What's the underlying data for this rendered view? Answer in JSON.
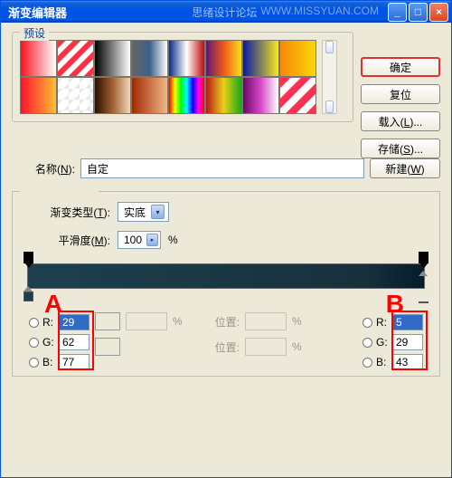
{
  "window": {
    "title": "渐变编辑器"
  },
  "watermark": {
    "a": "思绪设计论坛",
    "b": "WWW.MISSYUAN.COM"
  },
  "buttons": {
    "ok": "确定",
    "reset": "复位",
    "load": "载入(L)...",
    "save": "存储(S)...",
    "new": "新建(W)"
  },
  "labels": {
    "presets": "预设",
    "name": "名称(N):",
    "name_n": "N",
    "gradtype": "渐变类型(T):",
    "gradtype_t": "T",
    "smooth": "平滑度(M):",
    "smooth_m": "M",
    "pct": "%",
    "pos": "位置:",
    "R": "R:",
    "G": "G:",
    "B": "B:",
    "A": "A",
    "Bmark": "B"
  },
  "values": {
    "name": "自定",
    "gradtype": "实底",
    "smooth": "100"
  },
  "rgbA": {
    "r": "29",
    "g": "62",
    "b": "77"
  },
  "rgbB": {
    "r": "5",
    "g": "29",
    "b": "43"
  },
  "preset_styles": [
    "linear-gradient(to right,#ff1020,#ffffff)",
    "repeating-linear-gradient(135deg,#ff3040 0 6px,#ffffff 6px 12px)",
    "linear-gradient(to right,#000,#fff)",
    "linear-gradient(to right,#666,#3a5f8a,#fff)",
    "linear-gradient(to right,#0a2a88,#fff,#c00808)",
    "linear-gradient(to right,#5a1878,#f05818,#f8e018)",
    "linear-gradient(to right,#0818a8,#f8e818)",
    "linear-gradient(to right,#f88808,#f8d808)",
    "linear-gradient(to right,#ff1030,#ffc030)",
    "linear-gradient(135deg,#e8e8e8 25%,transparent 25%) 0 0/12px 12px,linear-gradient(135deg,transparent 75%,#e8e8e8 75%) 0 0/12px 12px,#fff",
    "linear-gradient(to right,#2a1000,#a06030,#f0d8b8)",
    "linear-gradient(to right,#a02800,#f0b888)",
    "linear-gradient(to right,#ff0000,#ffff00,#00ff00,#00ffff,#0000ff,#ff00ff,#ff0000)",
    "linear-gradient(to right,#b81818,#e8d018,#18a818)",
    "linear-gradient(to right,#6a0868,#d848c8,#fff)",
    "repeating-linear-gradient(135deg,#ff3050 0 8px,#ffffff 8px 16px)"
  ]
}
